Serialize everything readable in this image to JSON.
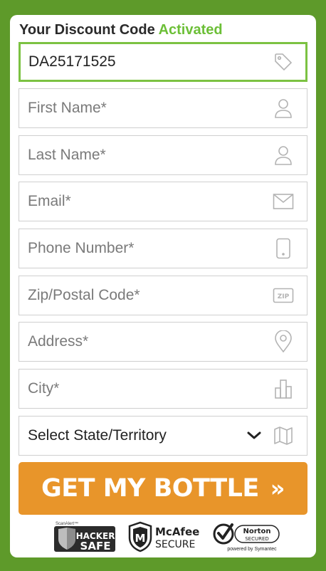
{
  "header": {
    "title": "Your Discount Code",
    "status": "Activated"
  },
  "form": {
    "discount_code": "DA25171525",
    "first_name_placeholder": "First Name*",
    "last_name_placeholder": "Last Name*",
    "email_placeholder": "Email*",
    "phone_placeholder": "Phone Number*",
    "zip_placeholder": "Zip/Postal Code*",
    "address_placeholder": "Address*",
    "city_placeholder": "City*",
    "state_selected": "Select State/Territory"
  },
  "cta": {
    "label": "GET MY BOTTLE",
    "arrows": "»"
  },
  "badges": {
    "hacker_safe": {
      "top": "ScanAlert™",
      "line1": "HACKER",
      "line2": "SAFE"
    },
    "mcafee": {
      "line1": "McAfee",
      "line2": "SECURE"
    },
    "norton": {
      "line1": "Norton",
      "line2": "SECURED",
      "footer": "powered by Symantec"
    }
  },
  "colors": {
    "background": "#5e9a2a",
    "accent_green": "#6cbf37",
    "cta": "#e8952a"
  }
}
